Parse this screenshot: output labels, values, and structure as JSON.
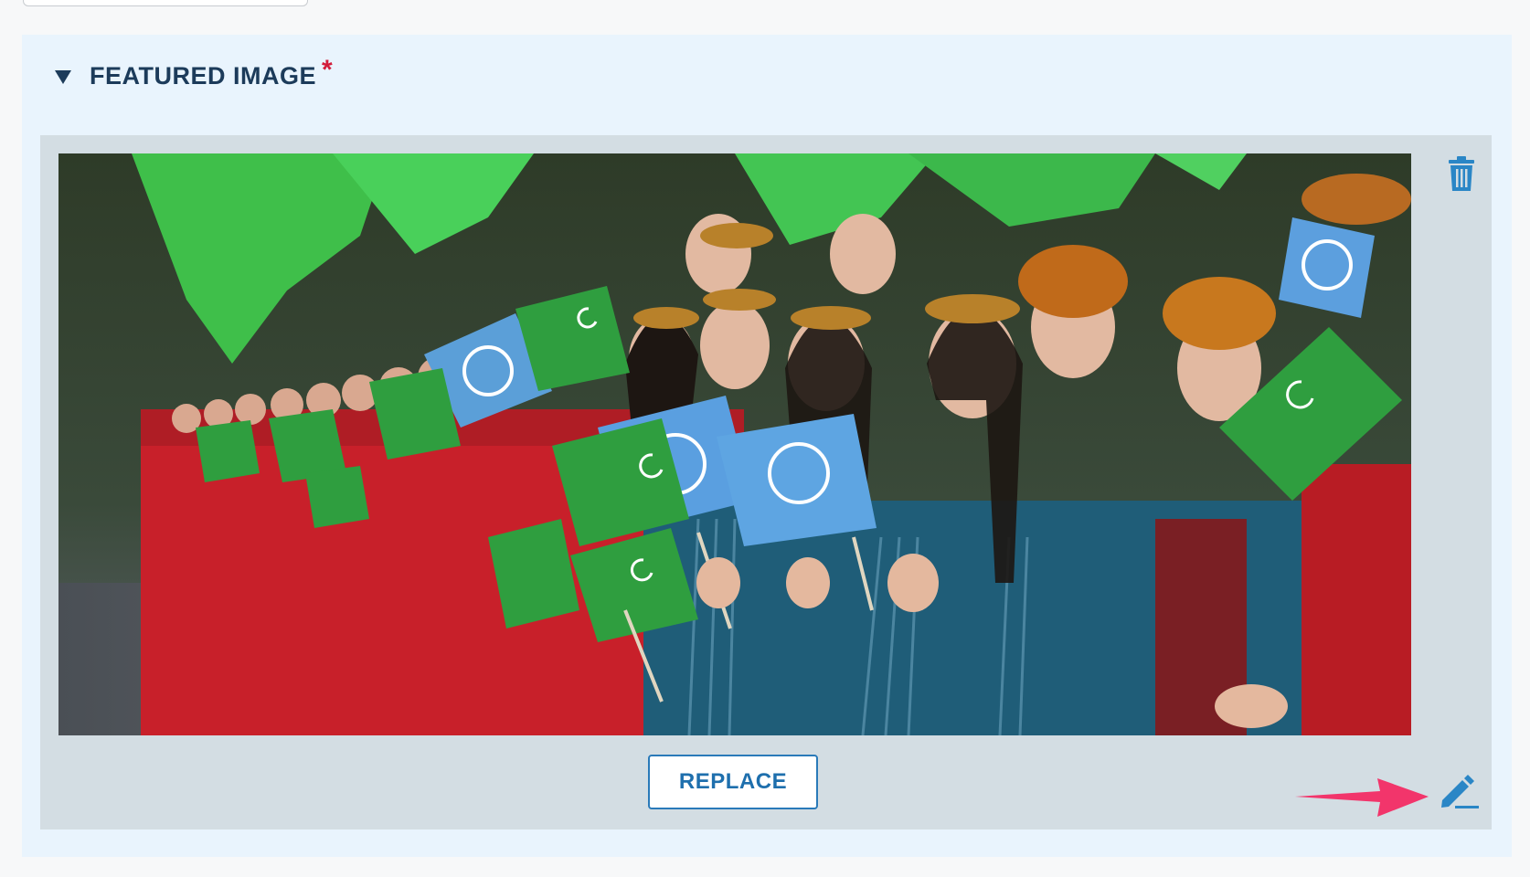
{
  "section": {
    "title": "FEATURED IMAGE",
    "required_marker": "*"
  },
  "media": {
    "replace_label": "REPLACE",
    "delete_icon": "trash-icon",
    "edit_icon": "pencil-icon"
  },
  "colors": {
    "section_bg": "#e9f4fd",
    "panel_bg": "#d3dde3",
    "accent": "#2a7ab9",
    "required": "#d21c3a",
    "annotation": "#f2356b"
  }
}
